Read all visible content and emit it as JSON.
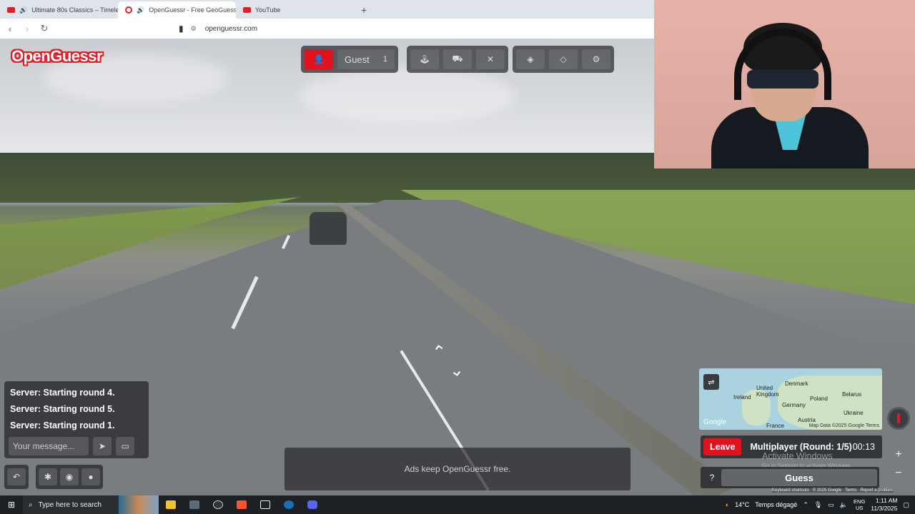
{
  "browser": {
    "tabs": [
      {
        "label": "Ultimate 80s Classics – Timeless",
        "icon": "youtube-icon"
      },
      {
        "label": "OpenGuessr - Free GeoGuess",
        "icon": "openguessr-icon",
        "active": true
      },
      {
        "label": "YouTube",
        "icon": "youtube-icon"
      }
    ],
    "new_tab": "+",
    "url": "openguessr.com"
  },
  "logo": "OpenGuessr",
  "toolbar": {
    "player_name": "Guest",
    "player_count": "1"
  },
  "chat": {
    "messages": [
      "Server: Starting round 4.",
      "Server: Starting round 5.",
      "Server: Starting round 1."
    ],
    "input_placeholder": "Your message..."
  },
  "ad": {
    "text": "Ads keep OpenGuessr free."
  },
  "map": {
    "labels": [
      "Denmark",
      "United Kingdom",
      "Ireland",
      "Belarus",
      "Poland",
      "Germany",
      "Ukraine",
      "Austria",
      "France"
    ],
    "attribution": "Map Data ©2025 Google",
    "terms": "Terms",
    "brand": "Google"
  },
  "game": {
    "leave_label": "Leave",
    "round_label": "Multiplayer (Round: 1/5)",
    "timer": "00:13",
    "help_label": "?",
    "guess_label": "Guess",
    "zoom_in": "+",
    "zoom_out": "−"
  },
  "watermark": {
    "line1": "Activate Windows",
    "line2": "Go to Settings to activate Windows."
  },
  "credits": {
    "shortcuts": "Keyboard shortcuts",
    "copyright": "© 2025 Google",
    "terms": "Terms",
    "report": "Report a problem"
  },
  "taskbar": {
    "search_placeholder": "Type here to search",
    "weather_temp": "14°C",
    "weather_text": "Temps dégagé",
    "lang_line1": "ENG",
    "lang_line2": "US",
    "time": "1:11 AM",
    "date": "11/3/2025"
  },
  "colors": {
    "accent_red": "#e0121e",
    "panel_bg": "#282a2e"
  }
}
